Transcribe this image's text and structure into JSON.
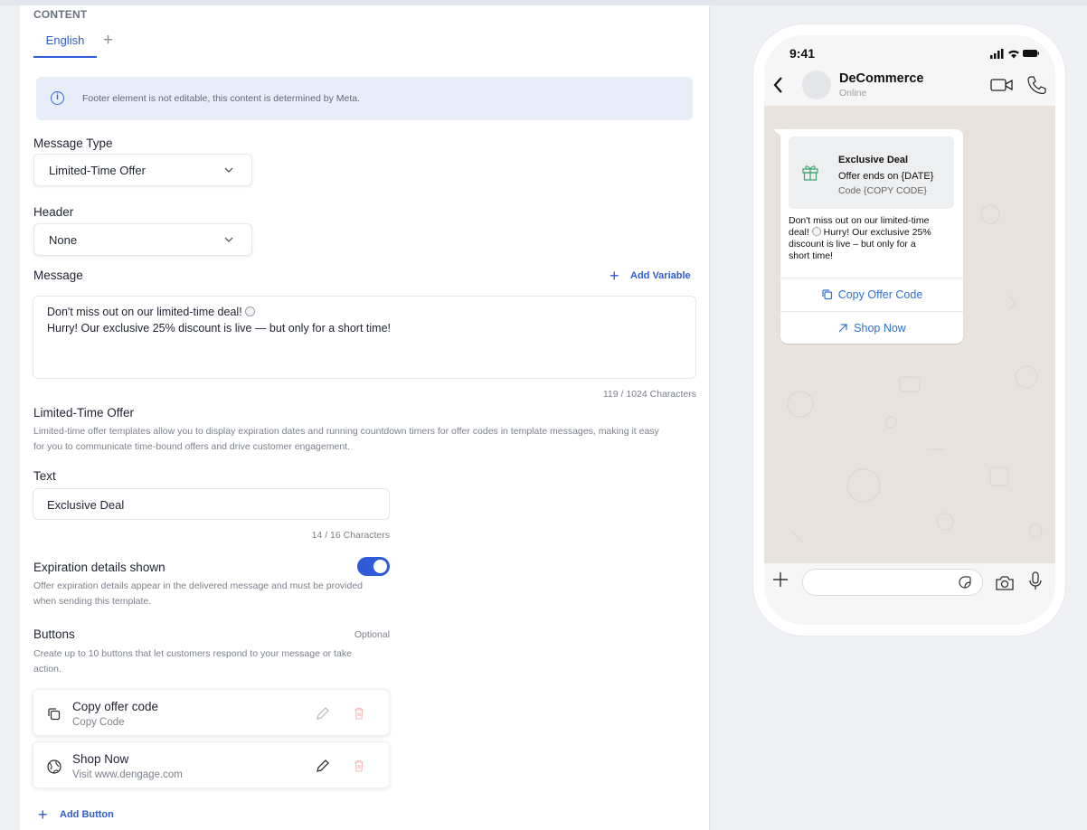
{
  "content": {
    "caption": "CONTENT",
    "language_tab": "English",
    "info_text": "Footer element is not editable, this content is determined by Meta."
  },
  "message_type": {
    "label": "Message Type",
    "value": "Limited-Time Offer"
  },
  "header": {
    "label": "Header",
    "value": "None"
  },
  "message": {
    "label": "Message",
    "add_variable": "Add Variable",
    "line1": "Don't miss out on our limited-time deal!",
    "line2": "Hurry! Our exclusive 25% discount is live — but only for a short time!",
    "counter": "119 / 1024 Characters"
  },
  "lto": {
    "label": "Limited-Time Offer",
    "description_line1": "Limited-time offer templates allow you to display expiration dates and running countdown timers for offer codes in template messages, making it easy",
    "description_line2": "for you to communicate time-bound offers and drive customer engagement."
  },
  "text_field": {
    "label": "Text",
    "value": "Exclusive Deal",
    "counter": "14 / 16 Characters"
  },
  "expiration": {
    "label": "Expiration details shown",
    "enabled": true,
    "desc_line1": "Offer expiration details appear in the delivered message and must be provided",
    "desc_line2": "when sending this template."
  },
  "buttons": {
    "label": "Buttons",
    "optional": "Optional",
    "desc_line1": "Create up to 10 buttons that let customers respond to your message or take",
    "desc_line2": "action.",
    "items": [
      {
        "title": "Copy offer code",
        "sub": "Copy Code",
        "icon": "copy-icon"
      },
      {
        "title": "Shop Now",
        "sub": "Visit www.dengage.com",
        "icon": "globe-icon"
      }
    ],
    "add_button": "Add Button"
  },
  "preview": {
    "time": "9:41",
    "contact": "DeCommerce",
    "status": "Online",
    "offer_title": "Exclusive Deal",
    "offer_line": "Offer ends on {DATE}",
    "offer_code": "Code {COPY CODE}",
    "msg_line1": "Don't miss out on our limited-time",
    "msg_line2": "deal!",
    "msg_line2b": "Hurry! Our exclusive 25%",
    "msg_line3": "discount is live  – but only for a",
    "msg_line4": "short time!",
    "btn_copy": "Copy Offer Code",
    "btn_shop": "Shop Now"
  },
  "colors": {
    "accent": "#2f5bd8",
    "info_bg": "#e8eef9",
    "wa_link": "#2f6fd6",
    "gift": "#3aa36f"
  }
}
